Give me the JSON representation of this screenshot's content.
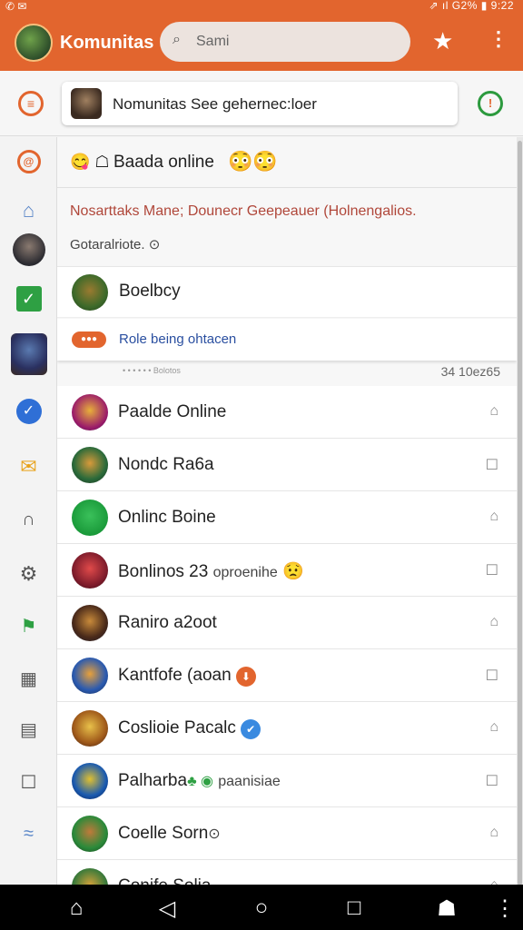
{
  "status_bar": {
    "left_icons": "✆ ✉",
    "right": "⇗ ıl G2% ▮ 9:22"
  },
  "app_bar": {
    "title": "Komunitas",
    "search_placeholder": "Sami",
    "search_icon": "search-icon",
    "star_icon": "star-icon",
    "more_icon": "more-vert-icon",
    "accent": "#e2652e"
  },
  "community_picker": {
    "label": "Nomunitas See gehernec:loer"
  },
  "header": {
    "title": "Baada online"
  },
  "notice": {
    "line1": "Nosarttaks Mane; Dounecr Geepeauer (Holnengalios.",
    "line2": "Gotaralriote. ⊙"
  },
  "featured": {
    "name": "Boelbcy",
    "status_tag": "●●●",
    "status_text": "Role being ohtacen"
  },
  "meta": {
    "left": "• • •  •  •  •  Bolotos",
    "right": "34 10ez65"
  },
  "list": [
    {
      "name": "Paalde Online",
      "suffix": "",
      "badge": ""
    },
    {
      "name": "Nondc Ra6a",
      "suffix": "",
      "badge": ""
    },
    {
      "name": "Onlinc Boine",
      "suffix": "",
      "badge": ""
    },
    {
      "name": "Bonlinos 23",
      "suffix": "oproenihe",
      "badge": "😟"
    },
    {
      "name": "Raniro a2oot",
      "suffix": "",
      "badge": ""
    },
    {
      "name": "Kantfofe (aoan",
      "suffix": "",
      "badge": "⬇"
    },
    {
      "name": "Coslioie Pacalc",
      "suffix": "",
      "badge": "✔"
    },
    {
      "name": "Palharba",
      "suffix": "paanisiae",
      "badge": "♣ ◉"
    },
    {
      "name": "Coelle Sorn",
      "suffix": "",
      "badge": "⊙"
    },
    {
      "name": "Conife Solia",
      "suffix": "",
      "badge": ""
    }
  ],
  "navbar": {
    "home": "home-icon",
    "back": "back-icon",
    "recents": "overview-icon",
    "profile": "profile-icon"
  }
}
